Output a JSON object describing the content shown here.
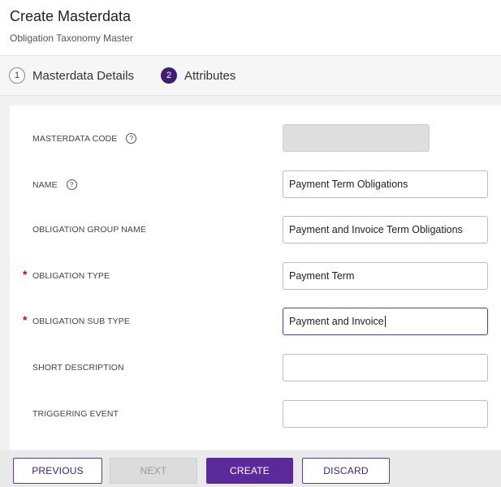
{
  "header": {
    "title": "Create Masterdata",
    "subtitle": "Obligation Taxonomy Master"
  },
  "stepper": {
    "steps": [
      {
        "number": "1",
        "label": "Masterdata Details",
        "state": "inactive"
      },
      {
        "number": "2",
        "label": "Attributes",
        "state": "active"
      }
    ]
  },
  "form": {
    "fields": [
      {
        "label": "MASTERDATA CODE",
        "value": "",
        "required": false,
        "help": "?",
        "disabled": true
      },
      {
        "label": "NAME",
        "value": "Payment Term Obligations",
        "required": false,
        "help": "?"
      },
      {
        "label": "OBLIGATION GROUP NAME",
        "value": "Payment and Invoice Term Obligations",
        "required": false
      },
      {
        "label": "OBLIGATION TYPE",
        "value": "Payment Term",
        "required": true,
        "required_mark": "*"
      },
      {
        "label": "OBLIGATION SUB TYPE",
        "value": "Payment and Invoice",
        "required": true,
        "required_mark": "*",
        "focused": true
      },
      {
        "label": "SHORT DESCRIPTION",
        "value": "",
        "required": false
      },
      {
        "label": "TRIGGERING EVENT",
        "value": "",
        "required": false
      }
    ]
  },
  "footer": {
    "previous_label": "PREVIOUS",
    "next_label": "NEXT",
    "create_label": "CREATE",
    "discard_label": "DISCARD"
  },
  "colors": {
    "accent": "#5b2a9a",
    "step_active": "#3e1f6f",
    "required": "#d0021b"
  }
}
